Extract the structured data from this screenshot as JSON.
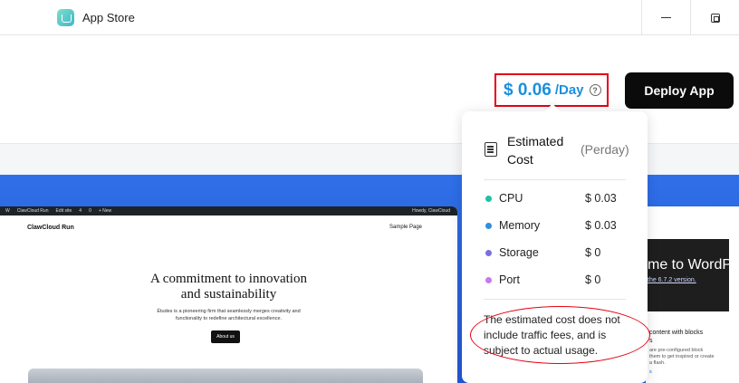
{
  "window": {
    "title": "App Store",
    "icon": "app-store-icon",
    "controls": [
      "minimize-icon",
      "restore-icon"
    ]
  },
  "header": {
    "price_value": "$ 0.06",
    "price_unit": "/Day",
    "help_symbol": "?",
    "deploy_label": "Deploy App",
    "highlight_color": "#e60012",
    "price_color": "#1a8fdf"
  },
  "preview_left": {
    "adminbar": [
      "W",
      "ClawCloud Run",
      "Edit site",
      "4",
      "0",
      "+ New"
    ],
    "adminbar_user": "Howdy, ClawCloud",
    "site_name": "ClawCloud Run",
    "nav": "Sample Page",
    "hero_title_1": "A commitment to innovation",
    "hero_title_2": "and sustainability",
    "hero_text_1": "Études is a pioneering firm that seamlessly merges creativity and",
    "hero_text_2": "functionality to redefine architectural excellence.",
    "button": "About us"
  },
  "preview_right": {
    "welcome": "me to WordP",
    "version_link": "the 6.7.2 version.",
    "block_title_1": "content with blocks",
    "block_title_2": "s",
    "block_text_1": "are pre-configured block",
    "block_text_2": "them to get inspired or create",
    "block_text_3": "a flash.",
    "link": "s"
  },
  "cost": {
    "title_line1": "Estimated",
    "title_line2": "Cost",
    "period": "(Perday)",
    "icon": "receipt-icon",
    "items": [
      {
        "label": "CPU",
        "value": "$ 0.03",
        "color": "#1fc0a5"
      },
      {
        "label": "Memory",
        "value": "$ 0.03",
        "color": "#2e8fe0"
      },
      {
        "label": "Storage",
        "value": "$ 0",
        "color": "#7b6fe0"
      },
      {
        "label": "Port",
        "value": "$ 0",
        "color": "#c47be8"
      }
    ],
    "note": "The estimated cost does not include traffic fees, and is subject to actual usage."
  }
}
